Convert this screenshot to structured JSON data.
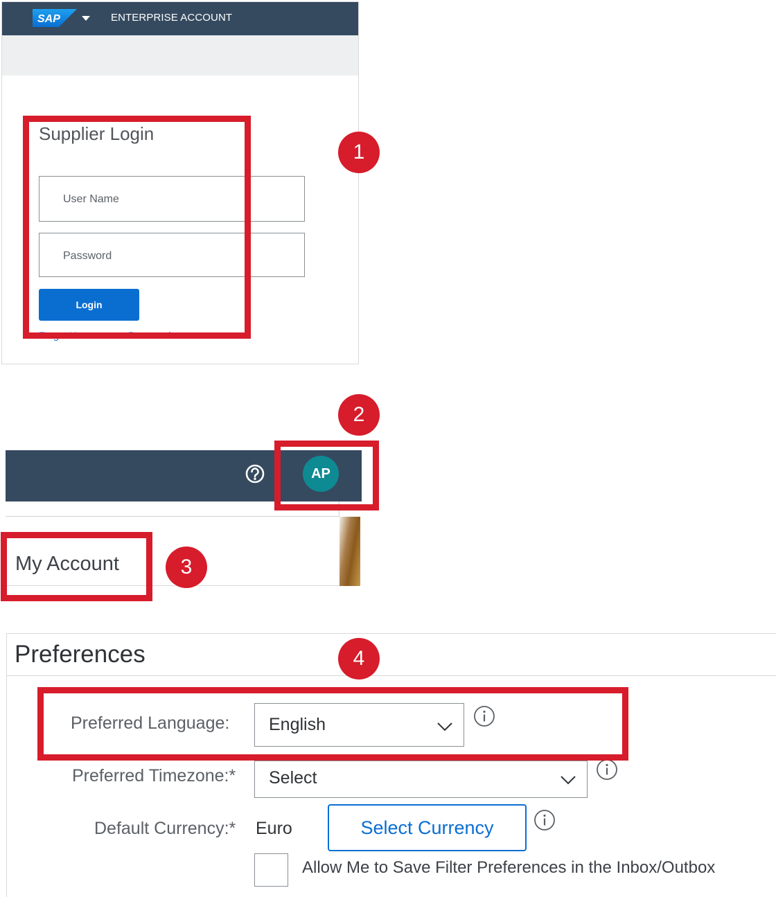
{
  "login_panel": {
    "header_title": "ENTERPRISE ACCOUNT",
    "logo_text": "SAP",
    "form_title": "Supplier Login",
    "username_placeholder": "User Name",
    "password_placeholder": "Password",
    "login_label": "Login",
    "forgot_link": "Forgot Username or Password"
  },
  "header_panel": {
    "avatar_initials": "AP",
    "menu_item": "My Account"
  },
  "preferences": {
    "title": "Preferences",
    "language_label": "Preferred Language:",
    "language_value": "English",
    "timezone_label": "Preferred Timezone:*",
    "timezone_value": "Select",
    "currency_label": "Default Currency:*",
    "currency_value": "Euro",
    "currency_button": "Select Currency",
    "filter_checkbox_label": "Allow Me to Save Filter Preferences in the Inbox/Outbox"
  },
  "annotations": {
    "step1": "1",
    "step2": "2",
    "step3": "3",
    "step4": "4"
  },
  "colors": {
    "header_bg": "#354a5f",
    "primary_blue": "#0a6ed1",
    "avatar_teal": "#0e8a93",
    "annotation_red": "#d71c2b"
  }
}
